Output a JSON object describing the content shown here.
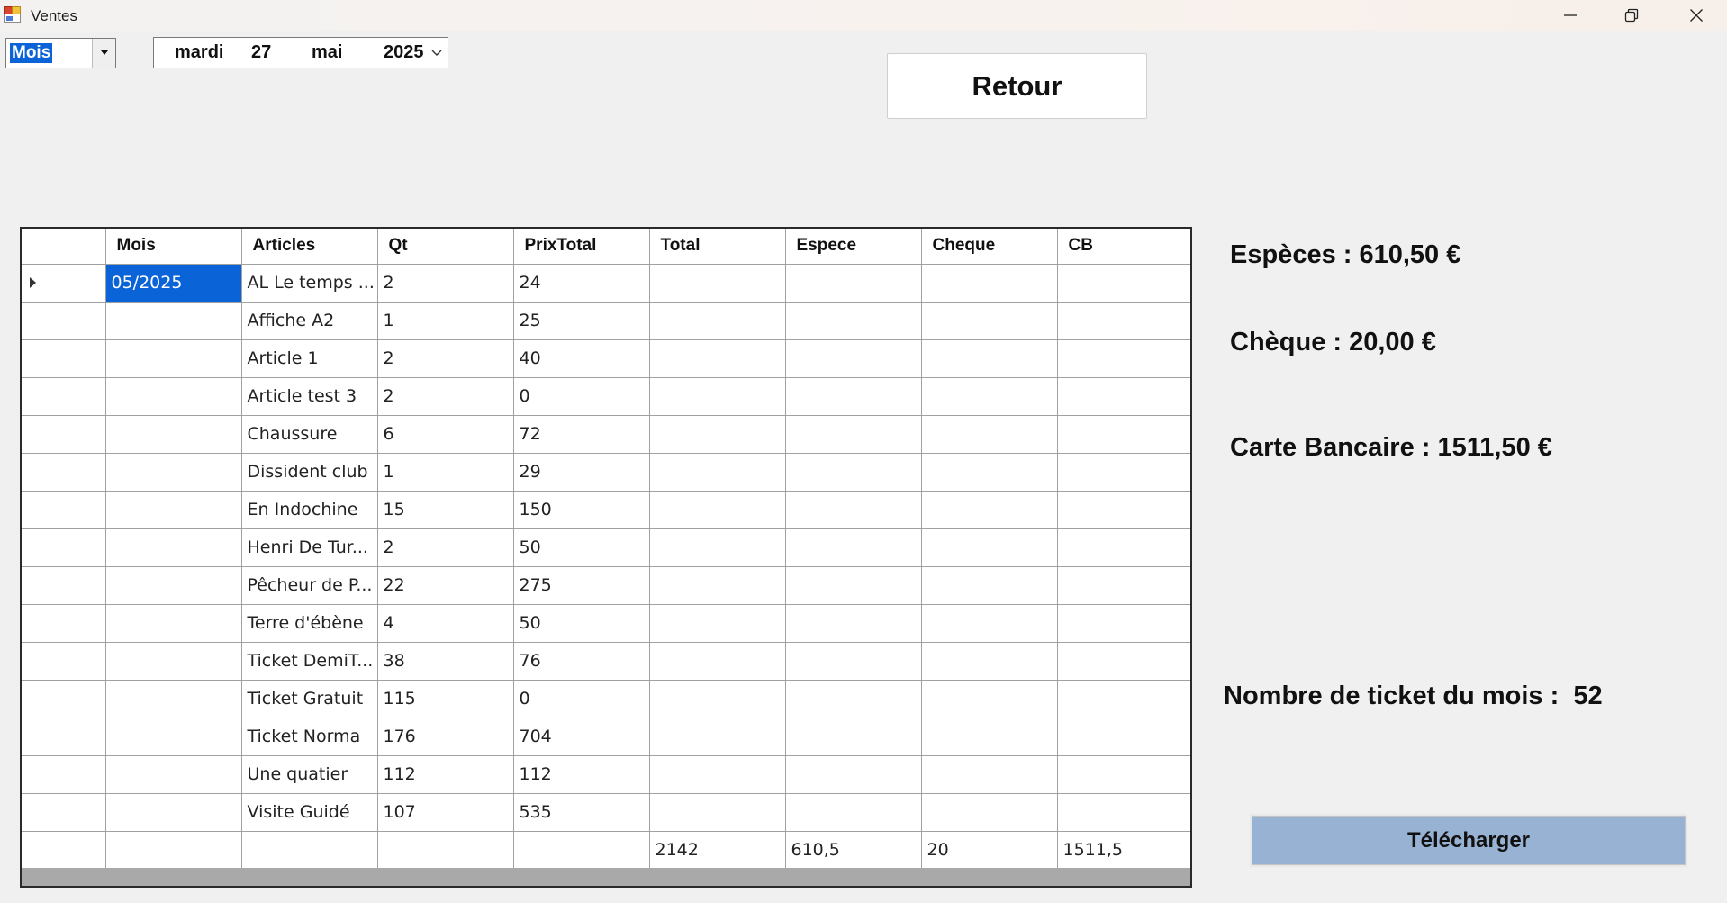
{
  "window": {
    "title": "Ventes"
  },
  "filter": {
    "period_value": "Mois"
  },
  "date_picker": {
    "weekday": "mardi",
    "day": "27",
    "month": "mai",
    "year": "2025"
  },
  "actions": {
    "retour_label": "Retour",
    "download_label": "Télécharger"
  },
  "grid": {
    "columns": [
      "Mois",
      "Articles",
      "Qt",
      "PrixTotal",
      "Total",
      "Espece",
      "Cheque",
      "CB"
    ],
    "rows": [
      [
        "05/2025",
        "AL Le temps ...",
        "2",
        "24",
        "",
        "",
        "",
        ""
      ],
      [
        "",
        "Affiche A2",
        "1",
        "25",
        "",
        "",
        "",
        ""
      ],
      [
        "",
        "Article 1",
        "2",
        "40",
        "",
        "",
        "",
        ""
      ],
      [
        "",
        "Article test 3",
        "2",
        "0",
        "",
        "",
        "",
        ""
      ],
      [
        "",
        "Chaussure",
        "6",
        "72",
        "",
        "",
        "",
        ""
      ],
      [
        "",
        "Dissident club",
        "1",
        "29",
        "",
        "",
        "",
        ""
      ],
      [
        "",
        "En Indochine",
        "15",
        "150",
        "",
        "",
        "",
        ""
      ],
      [
        "",
        "Henri De Tur...",
        "2",
        "50",
        "",
        "",
        "",
        ""
      ],
      [
        "",
        "Pêcheur de P...",
        "22",
        "275",
        "",
        "",
        "",
        ""
      ],
      [
        "",
        "Terre d'ébène",
        "4",
        "50",
        "",
        "",
        "",
        ""
      ],
      [
        "",
        "Ticket DemiT...",
        "38",
        "76",
        "",
        "",
        "",
        ""
      ],
      [
        "",
        "Ticket Gratuit",
        "115",
        "0",
        "",
        "",
        "",
        ""
      ],
      [
        "",
        "Ticket Norma",
        "176",
        "704",
        "",
        "",
        "",
        ""
      ],
      [
        "",
        "Une quatier",
        "112",
        "112",
        "",
        "",
        "",
        ""
      ],
      [
        "",
        "Visite Guidé",
        "107",
        "535",
        "",
        "",
        "",
        ""
      ],
      [
        "",
        "",
        "",
        "",
        "2142",
        "610,5",
        "20",
        "1511,5"
      ]
    ]
  },
  "summary": {
    "especes": "Espèces : 610,50 €",
    "cheque": "Chèque : 20,00 €",
    "carte": "Carte Bancaire : 1511,50 €",
    "tickets_label": "Nombre de ticket du mois :",
    "tickets_value": "52"
  }
}
